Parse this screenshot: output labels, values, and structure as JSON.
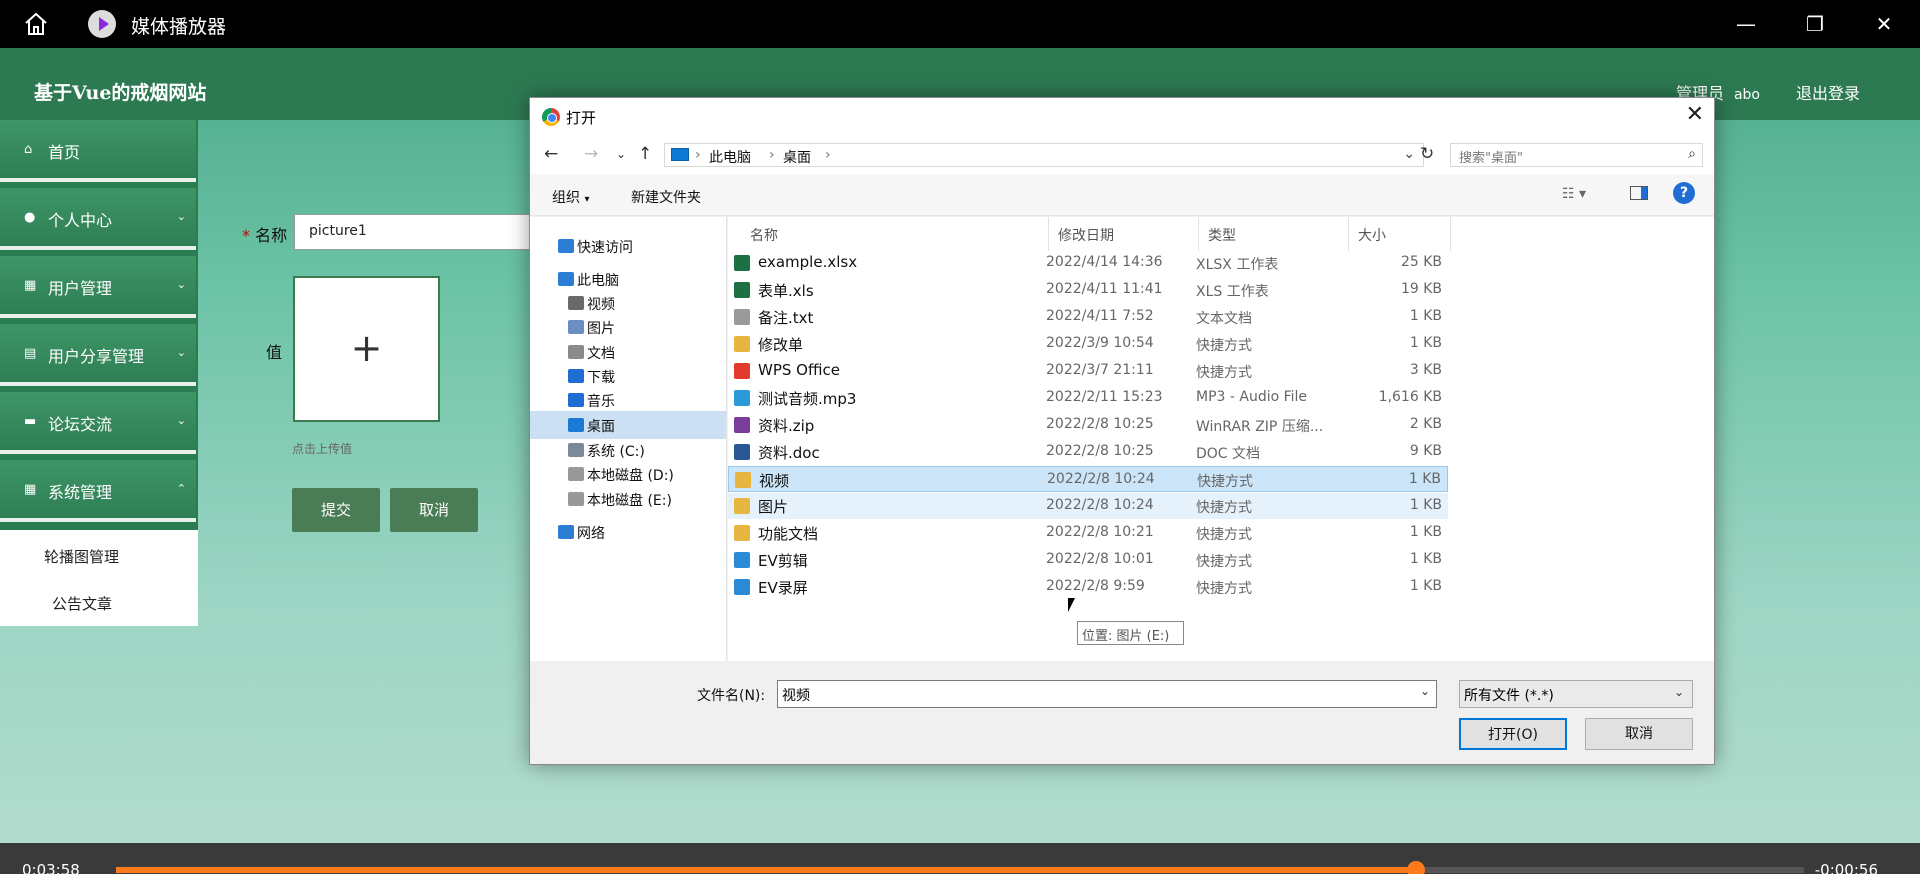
{
  "player": {
    "title": "媒体播放器",
    "time_elapsed": "0:03:58",
    "time_remaining": "-0:00:56",
    "progress": 0.77
  },
  "site": {
    "title": "基于Vue的戒烟网站",
    "role": "管理员",
    "user": "abo",
    "logout": "退出登录"
  },
  "sidebar": {
    "items": [
      {
        "label": "首页",
        "icon": "home-icon"
      },
      {
        "label": "个人中心",
        "icon": "user-icon"
      },
      {
        "label": "用户管理",
        "icon": "grid-icon"
      },
      {
        "label": "用户分享管理",
        "icon": "doc-icon"
      },
      {
        "label": "论坛交流",
        "icon": "monitor-icon"
      },
      {
        "label": "系统管理",
        "icon": "grid-icon"
      }
    ],
    "submenu": [
      "轮播图管理",
      "公告文章"
    ]
  },
  "form": {
    "name_label": "名称",
    "name_value": "picture1",
    "value_label": "值",
    "upload_hint": "点击上传值",
    "submit": "提交",
    "cancel": "取消",
    "required_mark": "*"
  },
  "dialog": {
    "title": "打开",
    "path": [
      "此电脑",
      "桌面"
    ],
    "search_placeholder": "搜索\"桌面\"",
    "organize": "组织",
    "new_folder": "新建文件夹",
    "nav": [
      {
        "label": "快速访问",
        "icon": "star-icon",
        "color": "#2a7fd4"
      },
      {
        "label": "此电脑",
        "icon": "pc-icon",
        "color": "#2a7fd4"
      },
      {
        "label": "视频",
        "icon": "video-folder-icon",
        "color": "#6a6a6a"
      },
      {
        "label": "图片",
        "icon": "picture-folder-icon",
        "color": "#6a8ec0"
      },
      {
        "label": "文档",
        "icon": "document-folder-icon",
        "color": "#8a8a8a"
      },
      {
        "label": "下载",
        "icon": "download-folder-icon",
        "color": "#1e6fd1"
      },
      {
        "label": "音乐",
        "icon": "music-folder-icon",
        "color": "#1e6fd1"
      },
      {
        "label": "桌面",
        "icon": "desktop-folder-icon",
        "color": "#1a7ad6"
      },
      {
        "label": "系统 (C:)",
        "icon": "drive-icon",
        "color": "#7a8a9a"
      },
      {
        "label": "本地磁盘 (D:)",
        "icon": "drive-icon",
        "color": "#999999"
      },
      {
        "label": "本地磁盘 (E:)",
        "icon": "drive-icon",
        "color": "#999999"
      },
      {
        "label": "网络",
        "icon": "network-icon",
        "color": "#2a7fd4"
      }
    ],
    "columns": {
      "name": "名称",
      "date": "修改日期",
      "type": "类型",
      "size": "大小"
    },
    "files": [
      {
        "name": "example.xlsx",
        "date": "2022/4/14 14:36",
        "type": "XLSX 工作表",
        "size": "25 KB",
        "icon": "excel-icon",
        "color": "#1d7044"
      },
      {
        "name": "表单.xls",
        "date": "2022/4/11 11:41",
        "type": "XLS 工作表",
        "size": "19 KB",
        "icon": "excel-icon",
        "color": "#1d7044"
      },
      {
        "name": "备注.txt",
        "date": "2022/4/11 7:52",
        "type": "文本文档",
        "size": "1 KB",
        "icon": "text-file-icon",
        "color": "#9a9a9a"
      },
      {
        "name": "修改单",
        "date": "2022/3/9 10:54",
        "type": "快捷方式",
        "size": "1 KB",
        "icon": "shortcut-icon",
        "color": "#e6b640"
      },
      {
        "name": "WPS Office",
        "date": "2022/3/7 21:11",
        "type": "快捷方式",
        "size": "3 KB",
        "icon": "wps-icon",
        "color": "#e23b2e"
      },
      {
        "name": "测试音频.mp3",
        "date": "2022/2/11 15:23",
        "type": "MP3 - Audio File",
        "size": "1,616 KB",
        "icon": "audio-file-icon",
        "color": "#2c9ad8"
      },
      {
        "name": "资料.zip",
        "date": "2022/2/8 10:25",
        "type": "WinRAR ZIP 压缩...",
        "size": "2 KB",
        "icon": "winrar-icon",
        "color": "#7a3e9a"
      },
      {
        "name": "资料.doc",
        "date": "2022/2/8 10:25",
        "type": "DOC 文档",
        "size": "9 KB",
        "icon": "word-file-icon",
        "color": "#2b5797"
      },
      {
        "name": "视频",
        "date": "2022/2/8 10:24",
        "type": "快捷方式",
        "size": "1 KB",
        "icon": "shortcut-icon",
        "color": "#e6b640"
      },
      {
        "name": "图片",
        "date": "2022/2/8 10:24",
        "type": "快捷方式",
        "size": "1 KB",
        "icon": "shortcut-icon",
        "color": "#e6b640"
      },
      {
        "name": "功能文档",
        "date": "2022/2/8 10:21",
        "type": "快捷方式",
        "size": "1 KB",
        "icon": "shortcut-icon",
        "color": "#e6b640"
      },
      {
        "name": "EV剪辑",
        "date": "2022/2/8 10:01",
        "type": "快捷方式",
        "size": "1 KB",
        "icon": "ev-edit-icon",
        "color": "#2a8ad6"
      },
      {
        "name": "EV录屏",
        "date": "2022/2/8 9:59",
        "type": "快捷方式",
        "size": "1 KB",
        "icon": "ev-record-icon",
        "color": "#2a8ad6"
      }
    ],
    "tooltip": "位置: 图片 (E:)",
    "filename_label": "文件名(N):",
    "filename_value": "视频",
    "filetype_value": "所有文件 (*.*)",
    "open_button": "打开(O)",
    "cancel_button": "取消"
  },
  "colors": {
    "accent_green": "#2d7a52",
    "progress": "#ff7a1a",
    "selection": "#cce5f8"
  }
}
